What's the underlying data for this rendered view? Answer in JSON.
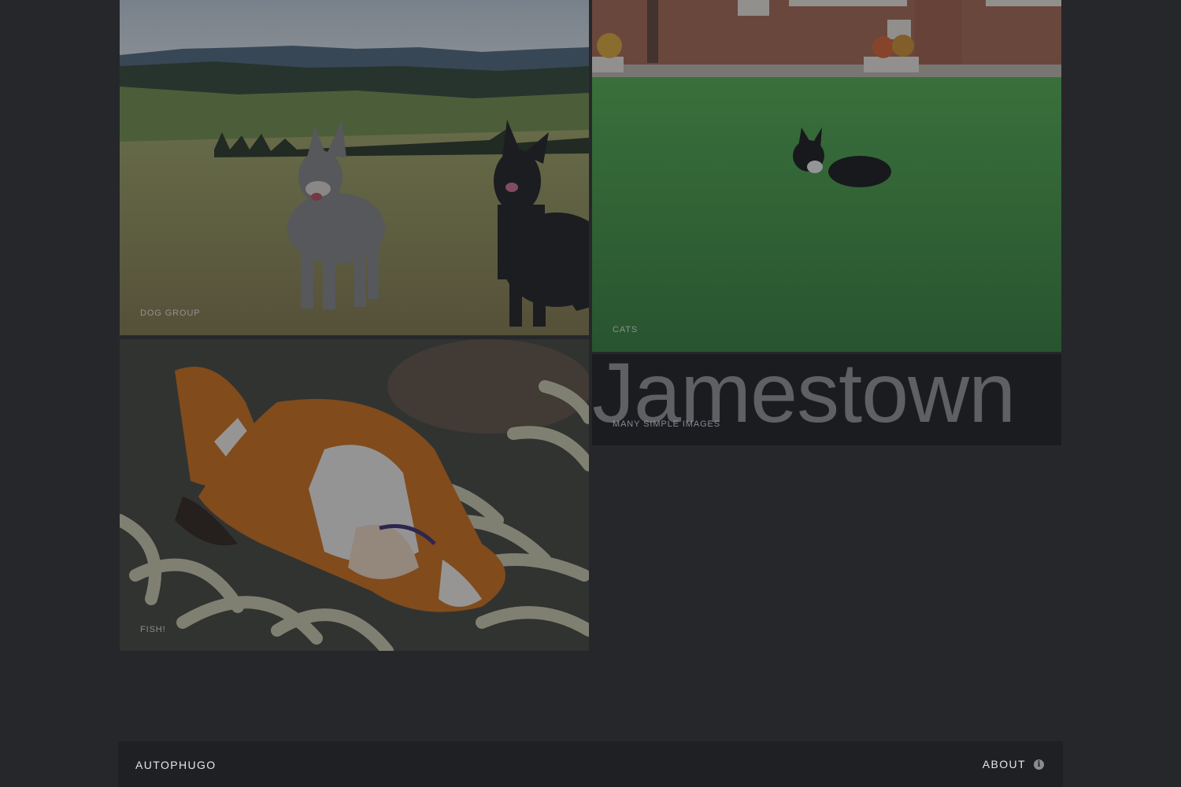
{
  "gallery": {
    "albums": [
      {
        "label": "Dog Group",
        "image": "two-dogs-on-hillside"
      },
      {
        "label": "Cats",
        "image": "cat-in-tall-grass"
      },
      {
        "label": "Fish!",
        "image": "clownfish-in-anemone"
      },
      {
        "label": "Many Simple Images",
        "image": "jamestown-text",
        "image_text": "Jamestown"
      }
    ]
  },
  "footer": {
    "brand": "AutoPhugo",
    "about_label": "About",
    "about_icon": "info-icon"
  },
  "colors": {
    "background": "#26272b",
    "footer_bg": "#1e2024",
    "text": "#e4e6ea"
  }
}
